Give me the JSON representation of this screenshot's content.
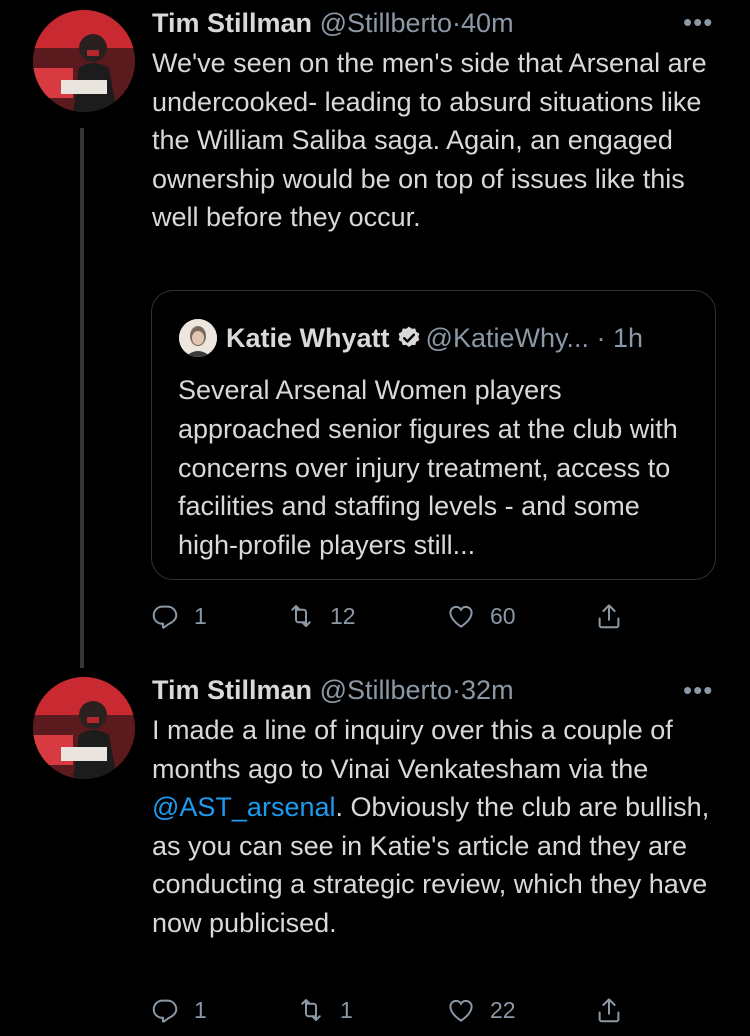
{
  "tweets": [
    {
      "name": "Tim Stillman",
      "handle": "@Stillberto",
      "sep": "·",
      "time": "40m",
      "more": "•••",
      "text": "We've seen on the men's side that Arsenal are undercooked- leading to absurd situations like the William Saliba saga. Again, an engaged ownership would be on top of issues like this well before they occur.",
      "quote": {
        "name": "Katie Whyatt",
        "handle": "@KatieWhy...",
        "time": "· 1h",
        "text": "Several Arsenal Women players approached senior figures at the club with concerns over injury treatment, access to facilities and staffing levels - and some high-profile players still..."
      },
      "actions": {
        "replies": "1",
        "retweets": "12",
        "likes": "60"
      }
    },
    {
      "name": "Tim Stillman",
      "handle": "@Stillberto",
      "sep": "·",
      "time": "32m",
      "more": "•••",
      "text_before": "I made a line of inquiry over this a couple of months ago to Vinai Venkatesham via the ",
      "mention": "@AST_arsenal",
      "text_after": ". Obviously the club are bullish, as you can see in Katie's article and they are conducting a strategic review, which they have now publicised.",
      "actions": {
        "replies": "1",
        "retweets": "1",
        "likes": "22"
      }
    }
  ],
  "colors": {
    "background": "#000000",
    "text": "#d9d9d9",
    "muted": "#8b98a5",
    "link": "#1d9bf0",
    "border": "#2f3336"
  },
  "icons": [
    "reply-icon",
    "retweet-icon",
    "like-icon",
    "share-icon",
    "verified-badge-icon",
    "more-icon"
  ]
}
